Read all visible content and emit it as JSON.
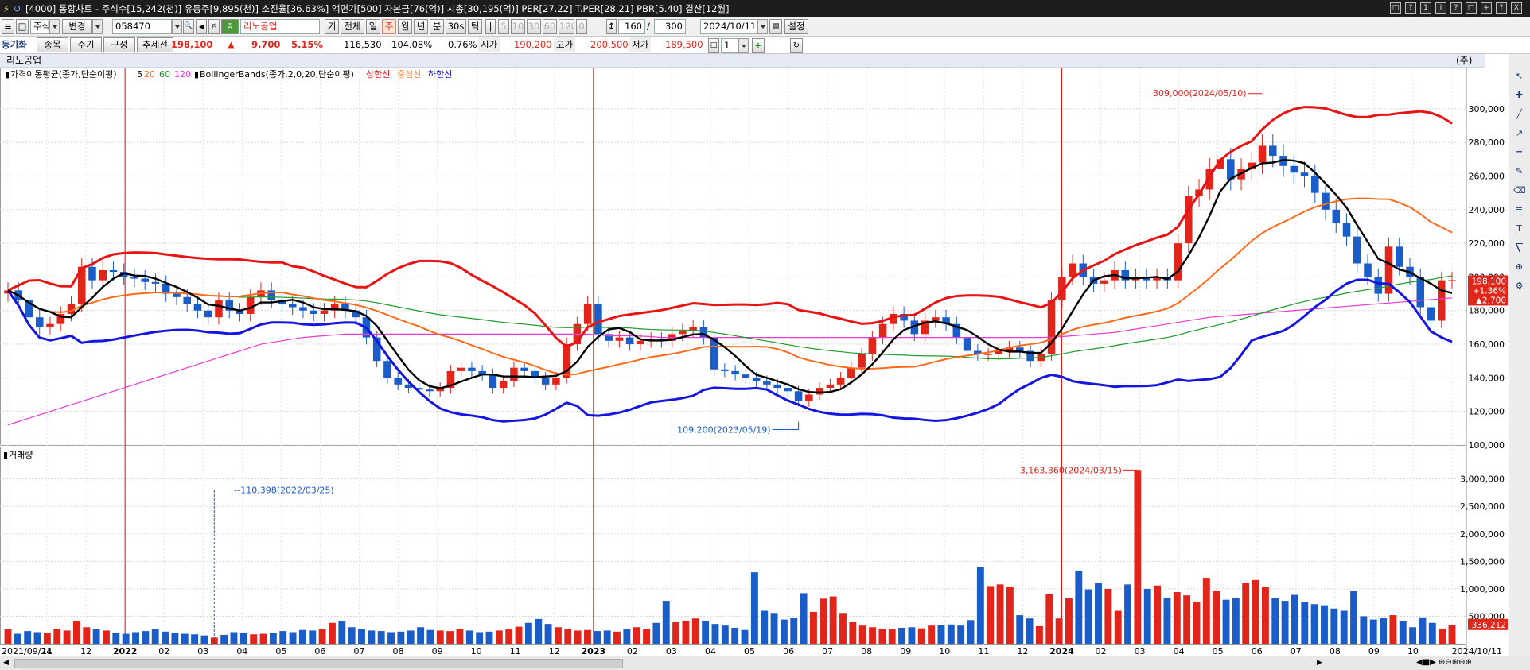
{
  "title_bar": {
    "text": "[4000] 통합차트 - 주식수[15,242(천)] 유동주[9,895(천)] 소진율[36.63%] 액면가[500] 자본금[76(억)] 시총[30,195(억)] PER[27.22] T.PER[28.21] PBR[5.40] 결산[12월]",
    "window_buttons": [
      "□",
      "?",
      "1",
      "I",
      "?",
      "□",
      "+",
      "?",
      "X"
    ]
  },
  "toolbar1": {
    "market": "주식",
    "change_label": "변경",
    "code": "058470",
    "name": "리노공업",
    "period_buttons": [
      "기",
      "전체",
      "일",
      "주",
      "월",
      "년",
      "분",
      "30s",
      "틱"
    ],
    "active_period": "주",
    "interval_buttons": [
      "5",
      "10",
      "30",
      "60",
      "120",
      "0"
    ],
    "count": "160",
    "slash": "/",
    "total": "300",
    "date": "2024/10/11",
    "settings": "설정"
  },
  "toolbar2": {
    "sync_label": "동기화",
    "tabs": [
      "종목",
      "주기",
      "구성",
      "추세선"
    ],
    "price": "198,100",
    "change_arrow": "▲",
    "change": "9,700",
    "change_pct": "5.15%",
    "volume": "116,530",
    "vol_ratio": "104.08%",
    "turnover": "0.76%",
    "open_label": "시가",
    "open": "190,200",
    "high_label": "고가",
    "high": "200,500",
    "low_label": "저가",
    "low": "189,500",
    "page_num": "1"
  },
  "stock_name": "리노공업",
  "stock_badge": "(주)",
  "colors": {
    "up": "#e1251b",
    "down": "#1a5cc8",
    "ma5": "#000000",
    "ma20": "#ff6a1a",
    "ma60": "#1f9a2b",
    "ma120": "#e83ad6",
    "upper": "#e81313",
    "lower": "#1515e0",
    "vline": "#e01010"
  },
  "icons": [
    "cursor-icon",
    "crosshair-icon",
    "line-icon",
    "trend-icon",
    "channel-icon",
    "pencil-icon",
    "eraser-icon",
    "fibonacci-icon",
    "text-icon",
    "ruler-icon",
    "zoom-icon",
    "gear-icon"
  ],
  "chart_data": [
    {
      "type": "candlestick",
      "title": "가격이동평균(종가,단순이평)",
      "ma_periods": [
        "5",
        "20",
        "60",
        "120"
      ],
      "bb_label": "BollingerBands(종가,2,0,20,단순이평)",
      "bb_lines": [
        "상한선",
        "중심선",
        "하한선"
      ],
      "ylim": [
        100000,
        316000
      ],
      "y_ticks": [
        "300,000",
        "280,000",
        "260,000",
        "240,000",
        "220,000",
        "200,000",
        "180,000",
        "160,000",
        "140,000",
        "120,000",
        "100,000"
      ],
      "x_ticks": [
        "2021/09/24",
        "11",
        "12",
        "2022",
        "02",
        "03",
        "04",
        "05",
        "06",
        "07",
        "08",
        "09",
        "10",
        "11",
        "12",
        "2023",
        "02",
        "03",
        "04",
        "05",
        "06",
        "07",
        "08",
        "09",
        "10",
        "11",
        "12",
        "2024",
        "02",
        "03",
        "04",
        "05",
        "06",
        "07",
        "08",
        "09",
        "10",
        "2024/10/11"
      ],
      "max_annotation": "309,000(2024/05/10)",
      "min_annotation": "109,200(2023/05/19)",
      "last_price": "198,100",
      "last_change_pct": "+1.36%",
      "last_change": "▲2,700",
      "weekly_close": [
        192000,
        186000,
        176000,
        170000,
        172000,
        178000,
        184000,
        206000,
        198000,
        204000,
        203000,
        200000,
        199000,
        197000,
        196000,
        190000,
        188000,
        184000,
        180000,
        176000,
        186000,
        180000,
        178000,
        188000,
        192000,
        186000,
        184000,
        182000,
        180000,
        178000,
        180000,
        184000,
        180000,
        176000,
        164000,
        150000,
        140000,
        136000,
        134000,
        133000,
        132000,
        134000,
        144000,
        146000,
        144000,
        142000,
        134000,
        138000,
        146000,
        144000,
        140000,
        136000,
        140000,
        160000,
        172000,
        184000,
        166000,
        162000,
        164000,
        160000,
        162000,
        163000,
        162000,
        166000,
        168000,
        170000,
        164000,
        145000,
        144000,
        142000,
        140000,
        138000,
        136000,
        134000,
        132000,
        126000,
        130000,
        134000,
        136000,
        140000,
        146000,
        154000,
        164000,
        172000,
        178000,
        174000,
        166000,
        174000,
        176000,
        172000,
        164000,
        156000,
        154000,
        154000,
        156000,
        158000,
        156000,
        150000,
        154000,
        186000,
        200000,
        208000,
        200000,
        196000,
        198000,
        204000,
        198000,
        200000,
        198000,
        200000,
        198000,
        220000,
        248000,
        252000,
        264000,
        270000,
        258000,
        264000,
        268000,
        278000,
        272000,
        266000,
        262000,
        260000,
        250000,
        240000,
        232000,
        224000,
        208000,
        200000,
        190000,
        218000,
        206000,
        200000,
        182000,
        174000,
        198000,
        198100
      ],
      "ma120": [
        112000,
        114000,
        116000,
        118000,
        120000,
        122000,
        124000,
        126000,
        128000,
        130000,
        132000,
        134000,
        136000,
        138000,
        140000,
        142000,
        144000,
        146000,
        148000,
        150000,
        152000,
        154000,
        156000,
        158000,
        160000,
        161000,
        162000,
        163000,
        164000,
        164500,
        165000,
        165500,
        166000,
        166000,
        166000,
        166000,
        166000,
        166000,
        166000,
        166000,
        166000,
        166000,
        166000,
        166000,
        166000,
        166000,
        166000,
        166000,
        166000,
        166000,
        166000,
        166000,
        166000,
        166000,
        166000,
        166000,
        165500,
        165000,
        165000,
        165000,
        164800,
        164500,
        164000,
        164000,
        164000,
        164000,
        164000,
        164000,
        164000,
        164000,
        164000,
        164000,
        164000,
        164000,
        164000,
        164000,
        164000,
        164000,
        164000,
        164000,
        164000,
        164000,
        164000,
        164000,
        164000,
        164000,
        164000,
        164000,
        164000,
        164000,
        164000,
        164000,
        164000,
        164000,
        164000,
        164000,
        164000,
        164000,
        164000,
        164200,
        164500,
        165000,
        165500,
        166000,
        166500,
        167000,
        168000,
        169000,
        170000,
        171000,
        172000,
        173000,
        174000,
        175000,
        176000,
        176500,
        177000,
        177500,
        178000,
        178500,
        179000,
        179500,
        180000,
        180500,
        181000,
        181500,
        182000,
        182500,
        183000,
        183500,
        184000,
        184500,
        185000,
        185500,
        186000,
        186500,
        187000,
        187500
      ]
    },
    {
      "type": "bar",
      "title": "거래량",
      "ylim": [
        0,
        3400000
      ],
      "y_ticks": [
        "3,000,000",
        "2,500,000",
        "2,000,000",
        "1,500,000",
        "1,000,000",
        "500,000"
      ],
      "max_annotation": "3,163,360(2024/03/15)",
      "min_annotation": "110,398(2022/03/25)",
      "last_volume": "336,212",
      "weekly_volume": [
        260000,
        180000,
        230000,
        210000,
        200000,
        270000,
        240000,
        420000,
        300000,
        260000,
        240000,
        200000,
        180000,
        210000,
        230000,
        260000,
        220000,
        200000,
        180000,
        170000,
        150000,
        110398,
        160000,
        210000,
        190000,
        170000,
        180000,
        200000,
        230000,
        210000,
        250000,
        240000,
        260000,
        380000,
        420000,
        300000,
        260000,
        240000,
        230000,
        210000,
        220000,
        240000,
        300000,
        250000,
        240000,
        230000,
        260000,
        240000,
        210000,
        220000,
        240000,
        260000,
        310000,
        380000,
        450000,
        360000,
        300000,
        260000,
        240000,
        250000,
        230000,
        240000,
        220000,
        260000,
        300000,
        270000,
        380000,
        780000,
        400000,
        420000,
        460000,
        420000,
        360000,
        330000,
        290000,
        250000,
        1300000,
        600000,
        560000,
        440000,
        470000,
        920000,
        580000,
        820000,
        860000,
        560000,
        400000,
        330000,
        300000,
        270000,
        260000,
        290000,
        300000,
        280000,
        330000,
        340000,
        350000,
        330000,
        430000,
        1400000,
        1050000,
        1080000,
        1040000,
        520000,
        460000,
        320000,
        900000,
        460000,
        830000,
        1330000,
        990000,
        1100000,
        1000000,
        600000,
        1080000,
        3163360,
        1000000,
        1060000,
        840000,
        940000,
        880000,
        760000,
        1200000,
        960000,
        800000,
        840000,
        1100000,
        1160000,
        1040000,
        830000,
        780000,
        890000,
        760000,
        720000,
        700000,
        640000,
        600000,
        960000,
        500000,
        440000,
        470000,
        520000,
        420000,
        300000,
        480000,
        380000,
        270000,
        336212
      ]
    }
  ]
}
